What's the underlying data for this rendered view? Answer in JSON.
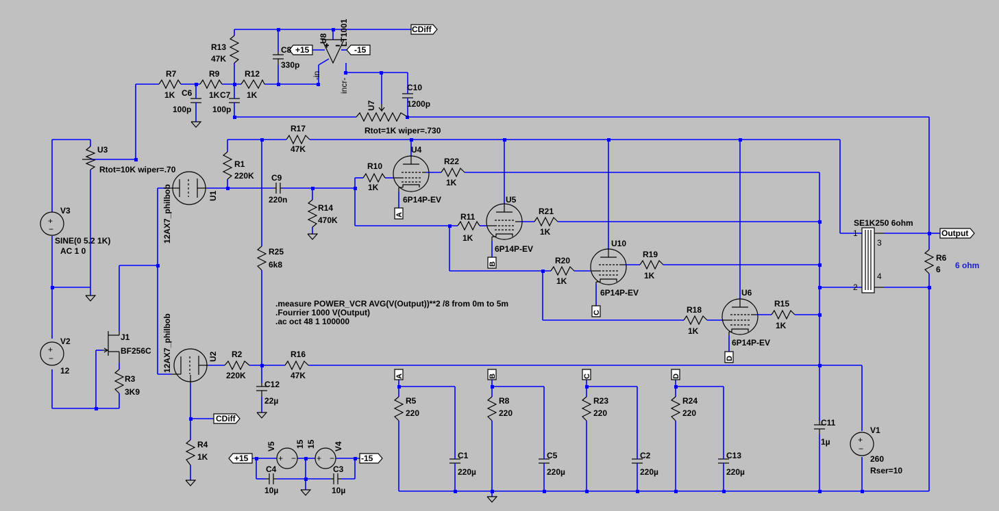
{
  "schematic": {
    "labels": {
      "R7": "R7",
      "R7v": "1K",
      "R9": "R9",
      "R9v": "1K",
      "C7": "C7",
      "C7v": "100p",
      "C6": "C6",
      "C6v": "100p",
      "R12": "R12",
      "R12v": "1K",
      "R13": "R13",
      "R13v": "47K",
      "C8": "C8",
      "C8v": "330p",
      "U8": "U8",
      "U8v": "LT1001",
      "C10": "C10",
      "C10v": "1200p",
      "U7": "U7",
      "U7v": "Rtot=1K wiper=.730",
      "U3": "U3",
      "U3v": "Rtot=10K wiper=.70",
      "V3": "V3",
      "V3v": "SINE(0 5.2 1K)",
      "V3ac": "AC 1 0",
      "V2": "V2",
      "V2v": "12",
      "J1": "J1",
      "J1v": "BF256C",
      "R3": "R3",
      "R3v": "3K9",
      "U1": "U1",
      "U1v": "12AX7_philbob",
      "U2": "U2",
      "U2v": "12AX7_philbob",
      "R1": "R1",
      "R1v": "220K",
      "R17": "R17",
      "R17v": "47K",
      "C9": "C9",
      "C9v": "220n",
      "R14": "R14",
      "R14v": "470K",
      "R25": "R25",
      "R25v": "6k8",
      "R2": "R2",
      "R2v": "220K",
      "R16": "R16",
      "R16v": "47K",
      "C12": "C12",
      "C12v": "22µ",
      "R4": "R4",
      "R4v": "1K",
      "R10": "R10",
      "R10v": "1K",
      "R22": "R22",
      "R22v": "1K",
      "U4": "U4",
      "U4v": "6P14P-EV",
      "R11": "R11",
      "R11v": "1K",
      "R21": "R21",
      "R21v": "1K",
      "U5": "U5",
      "U5v": "6P14P-EV",
      "R20": "R20",
      "R20v": "1K",
      "R19": "R19",
      "R19v": "1K",
      "U10": "U10",
      "U10v": "6P14P-EV",
      "R18": "R18",
      "R18v": "1K",
      "R15": "R15",
      "R15v": "1K",
      "U6": "U6",
      "U6v": "6P14P-EV",
      "TX": "SE1K250 6ohm",
      "R6": "R6",
      "R6v": "6",
      "R6n": "6 ohm",
      "R5": "R5",
      "R5v": "220",
      "C1": "C1",
      "C1v": "220µ",
      "R8": "R8",
      "R8v": "220",
      "C5": "C5",
      "C5v": "220µ",
      "R23": "R23",
      "R23v": "220",
      "C2": "C2",
      "C2v": "220µ",
      "R24": "R24",
      "R24v": "220",
      "C13": "C13",
      "C13v": "220µ",
      "C11": "C11",
      "C11v": "1µ",
      "V1": "V1",
      "V1v": "260",
      "V1r": "Rser=10",
      "V5": "V5",
      "V5v": "15",
      "V4": "V4",
      "V4v": "15",
      "C4": "C4",
      "C4v": "10µ",
      "C3": "C3",
      "C3v": "10µ",
      "pin1": "1",
      "pin2": "2",
      "pin3": "3",
      "pin4": "4",
      "in": "-in",
      "incr": "incr-"
    },
    "flags": {
      "cdiff": "CDiff",
      "output": "Output",
      "p15": "+15",
      "m15": "-15",
      "a": "A",
      "b": "B",
      "c": "C",
      "d": "D"
    },
    "directives": [
      ".measure POWER_VCR AVG(V(Output))**2 /8 from 0m to 5m",
      ".Fourrier 1000 V(Output)",
      ".ac oct 48 1 100000"
    ],
    "colors": {
      "wire": "#0000ff",
      "background": "#c0c0c0",
      "component": "#000000",
      "accent_text": "#1a1adb"
    }
  }
}
